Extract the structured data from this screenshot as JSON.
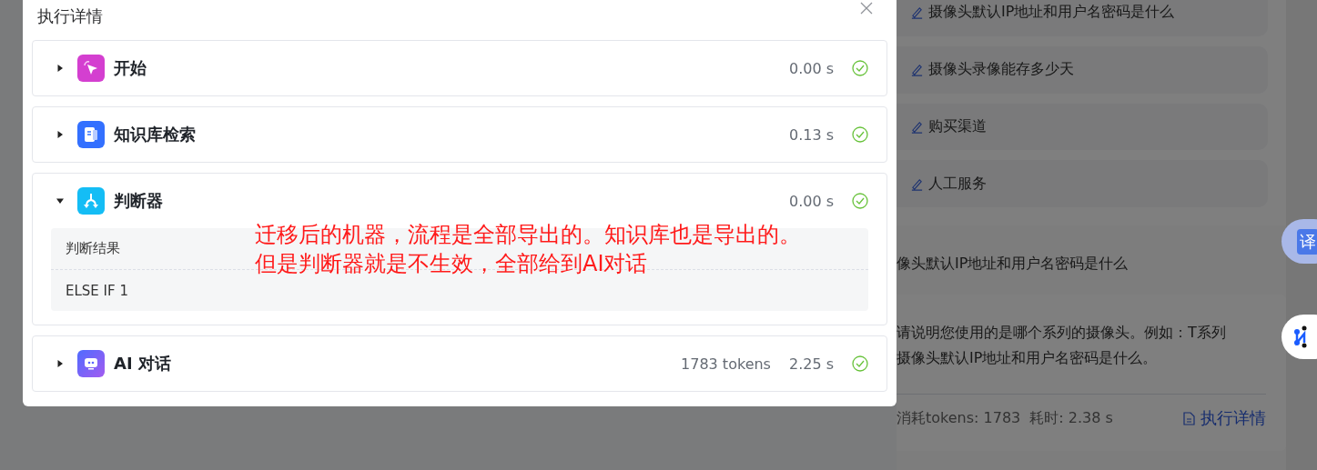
{
  "background": {
    "suggestions": [
      {
        "text": "摄像头默认IP地址和用户名密码是什么"
      },
      {
        "text": "摄像头录像能存多少天"
      },
      {
        "text": "购买渠道"
      },
      {
        "text": "人工服务"
      }
    ],
    "question": "像头默认IP地址和用户名密码是什么",
    "answer": [
      "请说明您使用的是哪个系列的摄像头。例如：T系列",
      "摄像头默认IP地址和用户名密码是什么。"
    ],
    "footer": {
      "tokens": "消耗tokens: 1783",
      "time": "耗时: 2.38 s",
      "link": "执行详情"
    },
    "translate_button": "译"
  },
  "dialog": {
    "title": "执行详情",
    "steps": [
      {
        "kind": "start",
        "name": "开始",
        "expanded": false,
        "duration": "0.00 s",
        "succeeded": true
      },
      {
        "kind": "knowledge",
        "name": "知识库检索",
        "expanded": false,
        "duration": "0.13 s",
        "succeeded": true
      },
      {
        "kind": "condition",
        "name": "判断器",
        "expanded": true,
        "duration": "0.00 s",
        "succeeded": true,
        "details": [
          "判断结果",
          "ELSE IF 1"
        ]
      },
      {
        "kind": "ai",
        "name": "AI 对话",
        "expanded": false,
        "tokens": "1783 tokens",
        "duration": "2.25 s",
        "succeeded": true
      }
    ]
  },
  "annotation": [
    "迁移后的机器，流程是全部导出的。知识库也是导出的。",
    "但是判断器就是不生效，全部给到AI对话"
  ]
}
